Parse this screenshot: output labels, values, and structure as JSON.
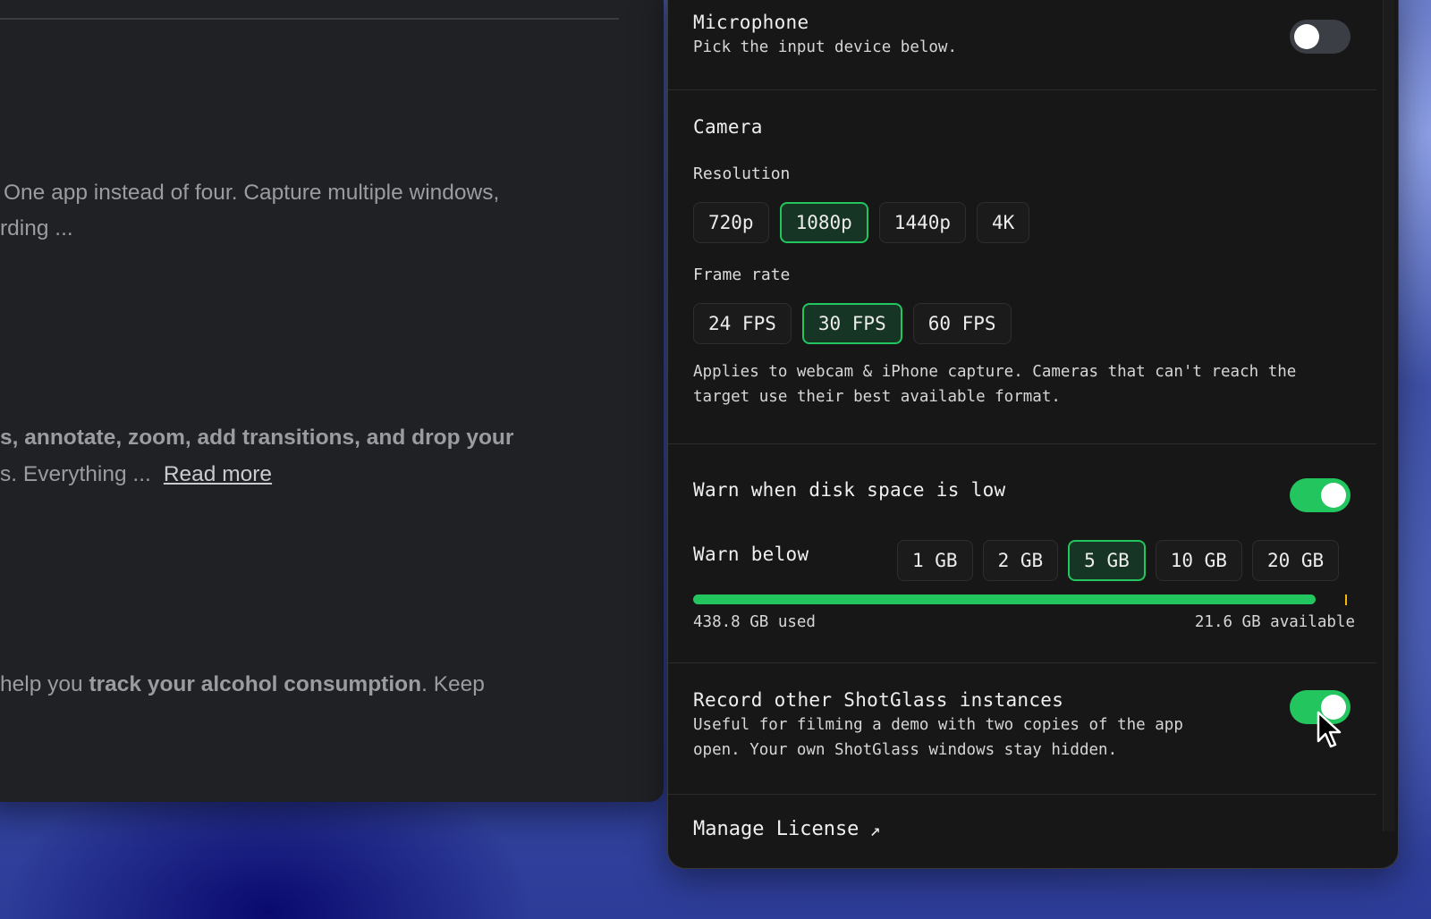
{
  "background_window": {
    "p1": "One app instead of four. Capture multiple windows,",
    "p2": "rding ...",
    "p3": "s, annotate, zoom, add transitions, and drop your",
    "p4": "s. Everything ...",
    "read_more": "Read more",
    "p5_pre": "help you ",
    "p5_bold": "track your alcohol consumption",
    "p5_post": ". Keep"
  },
  "microphone": {
    "title": "Microphone",
    "subtitle": "Pick the input device below.",
    "enabled": false
  },
  "camera": {
    "title": "Camera",
    "resolution_label": "Resolution",
    "resolutions": [
      "720p",
      "1080p",
      "1440p",
      "4K"
    ],
    "resolution_selected": "1080p",
    "framerate_label": "Frame rate",
    "framerates": [
      "24 FPS",
      "30 FPS",
      "60 FPS"
    ],
    "framerate_selected": "30 FPS",
    "note_line1": "Applies to webcam & iPhone capture. Cameras that can't reach the",
    "note_line2": "target use their best available format."
  },
  "disk": {
    "title": "Warn when disk space is low",
    "enabled": true,
    "warn_below_label": "Warn below",
    "thresholds": [
      "1 GB",
      "2 GB",
      "5 GB",
      "10 GB",
      "20 GB"
    ],
    "threshold_selected": "5 GB",
    "used_label": "438.8 GB used",
    "available_label": "21.6 GB available",
    "used_fraction": 0.953
  },
  "record_instances": {
    "title": "Record other ShotGlass instances",
    "desc_line1": "Useful for filming a demo with two copies of the app",
    "desc_line2": "open. Your own ShotGlass windows stay hidden.",
    "enabled": true
  },
  "manage_license": {
    "label": "Manage License",
    "icon": "arrow-up-right-icon"
  },
  "colors": {
    "accent": "#22c55e",
    "panel_bg": "#171717",
    "marker": "#f5b800"
  }
}
